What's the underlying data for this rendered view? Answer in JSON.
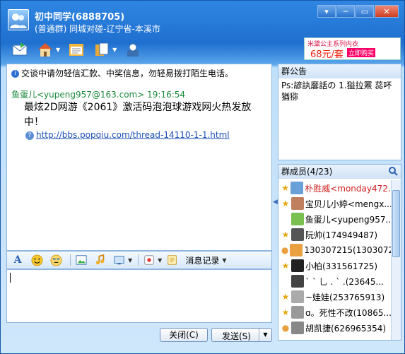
{
  "window": {
    "title": "初中同学(6888705)",
    "subtitle": "(普通群) 同城对碰-辽宁省-本溪市",
    "buttons": [
      "─",
      "▭",
      "✕"
    ]
  },
  "toolbar": {
    "icons": [
      "mail-icon",
      "home-icon",
      "calendar-icon",
      "share-icon",
      "tools-icon"
    ]
  },
  "ad": {
    "line1": "米黛公主系列内衣",
    "price": "68元/套",
    "cta": "立即购买"
  },
  "chat": {
    "notice": "交谈中请勿轻信汇款、中奖信息，勿轻易拨打陌生电话。",
    "messages": [
      {
        "sender": "鱼蛋儿<yupeng957@163.com>",
        "time": "19:16:54",
        "text": "最炫2D网游《2061》激活码泡泡球游戏网火热发放中！",
        "link": "http://bbs.popqiu.com/thread-14110-1-1.html"
      }
    ]
  },
  "format_toolbar": {
    "history_label": "消息记录"
  },
  "buttons": {
    "close": "关闭(C)",
    "send": "发送(S)"
  },
  "announcement": {
    "header": "群公告",
    "text": "Ps:諺訙黁話の 1.獈拉罴 蕊吥猶猕"
  },
  "members": {
    "header": "群成员(4/23)",
    "list": [
      {
        "name": "朴胜威<monday472...",
        "role": "star",
        "color": "#d02020"
      },
      {
        "name": "宝贝儿小婷<mengx...",
        "role": "star",
        "color": "#000000"
      },
      {
        "name": "鱼蛋儿<yupeng957...",
        "role": "none",
        "color": "#000000"
      },
      {
        "name": "阮帅(174949487)",
        "role": "star",
        "color": "#000000"
      },
      {
        "name": "130307215(1303072...",
        "role": "user",
        "color": "#000000"
      },
      {
        "name": "小柏(331561725)",
        "role": "star",
        "color": "#000000"
      },
      {
        "name": "` ` 乚 . ` .(23645...",
        "role": "none",
        "color": "#000000"
      },
      {
        "name": "~娃娃(253765913)",
        "role": "star",
        "color": "#000000"
      },
      {
        "name": "ɑ。死性不改(10865...",
        "role": "star",
        "color": "#000000"
      },
      {
        "name": "胡凯捷(626965354)",
        "role": "user",
        "color": "#000000"
      }
    ]
  }
}
